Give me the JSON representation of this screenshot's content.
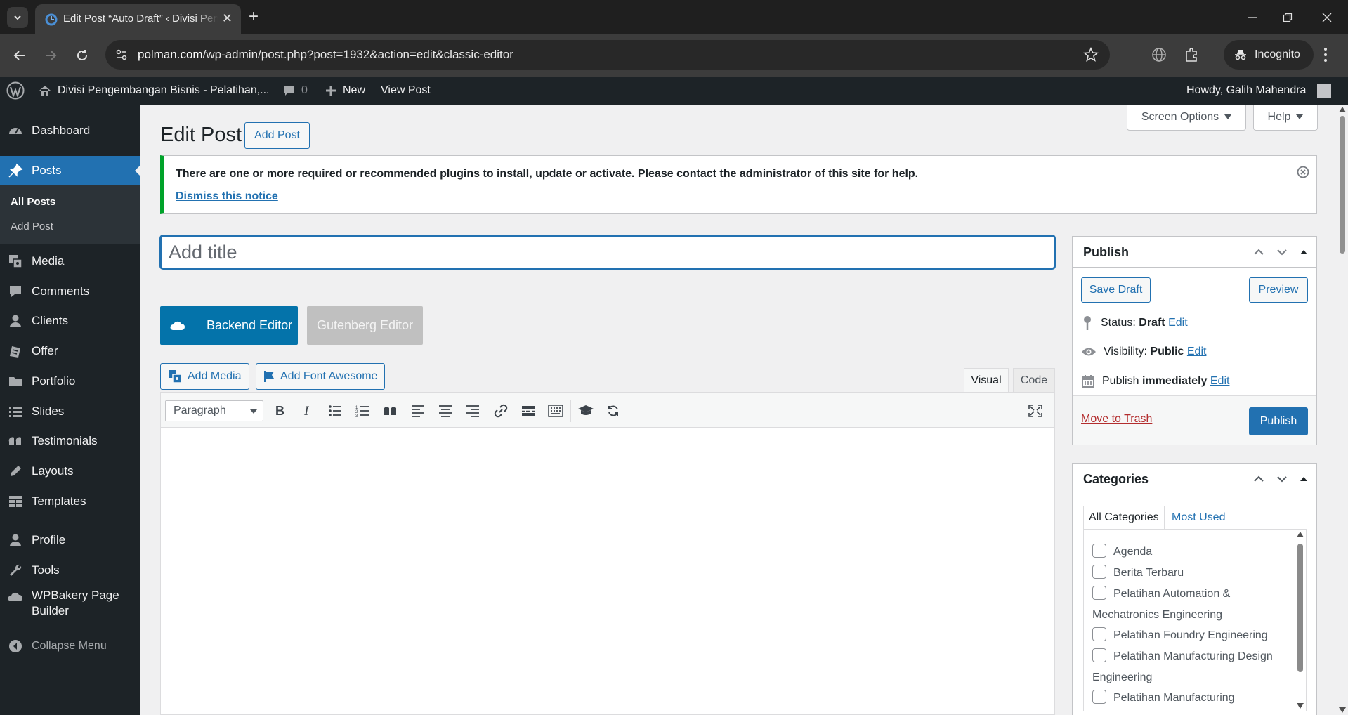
{
  "browser": {
    "tab_title": "Edit Post “Auto Draft” ‹ Divisi Pengembangan Bisnis",
    "url_host": "polman.com",
    "url_path": "/wp-admin/post.php?post=1932&action=edit&classic-editor",
    "incognito_label": "Incognito"
  },
  "adminbar": {
    "site_name": "Divisi Pengembangan Bisnis - Pelatihan,...",
    "comments_count": "0",
    "new_label": "New",
    "view_post_label": "View Post",
    "howdy": "Howdy, Galih Mahendra"
  },
  "sidebar": {
    "dashboard": "Dashboard",
    "posts": "Posts",
    "all_posts": "All Posts",
    "add_post": "Add Post",
    "media": "Media",
    "comments": "Comments",
    "clients": "Clients",
    "offer": "Offer",
    "portfolio": "Portfolio",
    "slides": "Slides",
    "testimonials": "Testimonials",
    "layouts": "Layouts",
    "templates": "Templates",
    "profile": "Profile",
    "tools": "Tools",
    "wpbakery_line1": "WPBakery Page",
    "wpbakery_line2": "Builder",
    "collapse": "Collapse Menu"
  },
  "header": {
    "screen_options": "Screen Options",
    "help": "Help",
    "page_title": "Edit Post",
    "add_post_button": "Add Post"
  },
  "notice": {
    "text": "There are one or more required or recommended plugins to install, update or activate. Please contact the administrator of this site for help.",
    "dismiss_link": "Dismiss this notice"
  },
  "editor": {
    "title_placeholder": "Add title",
    "backend_editor": "Backend Editor",
    "gutenberg_editor": "Gutenberg Editor",
    "add_media": "Add Media",
    "add_font_awesome": "Add Font Awesome",
    "tab_visual": "Visual",
    "tab_code": "Code",
    "format_select": "Paragraph"
  },
  "publish": {
    "title": "Publish",
    "save_draft": "Save Draft",
    "preview": "Preview",
    "status_label": "Status:",
    "status_value": "Draft",
    "visibility_label": "Visibility:",
    "visibility_value": "Public",
    "publish_label": "Publish",
    "publish_value": "immediately",
    "edit": "Edit",
    "move_to_trash": "Move to Trash",
    "publish_button": "Publish"
  },
  "categories": {
    "title": "Categories",
    "tab_all": "All Categories",
    "tab_most_used": "Most Used",
    "items": [
      {
        "label": "Agenda"
      },
      {
        "label": "Berita Terbaru"
      },
      {
        "label": "Pelatihan Automation &",
        "continuation": "Mechatronics Engineering"
      },
      {
        "label": "Pelatihan Foundry Engineering"
      },
      {
        "label": "Pelatihan Manufacturing Design",
        "continuation": "Engineering"
      },
      {
        "label": "Pelatihan Manufacturing"
      }
    ]
  },
  "colors": {
    "wp_blue": "#2271b1",
    "admin_dark": "#1d2327",
    "notice_green": "#00a32a",
    "trash_red": "#b32d2e",
    "wpbakery_blue": "#0473aa"
  }
}
